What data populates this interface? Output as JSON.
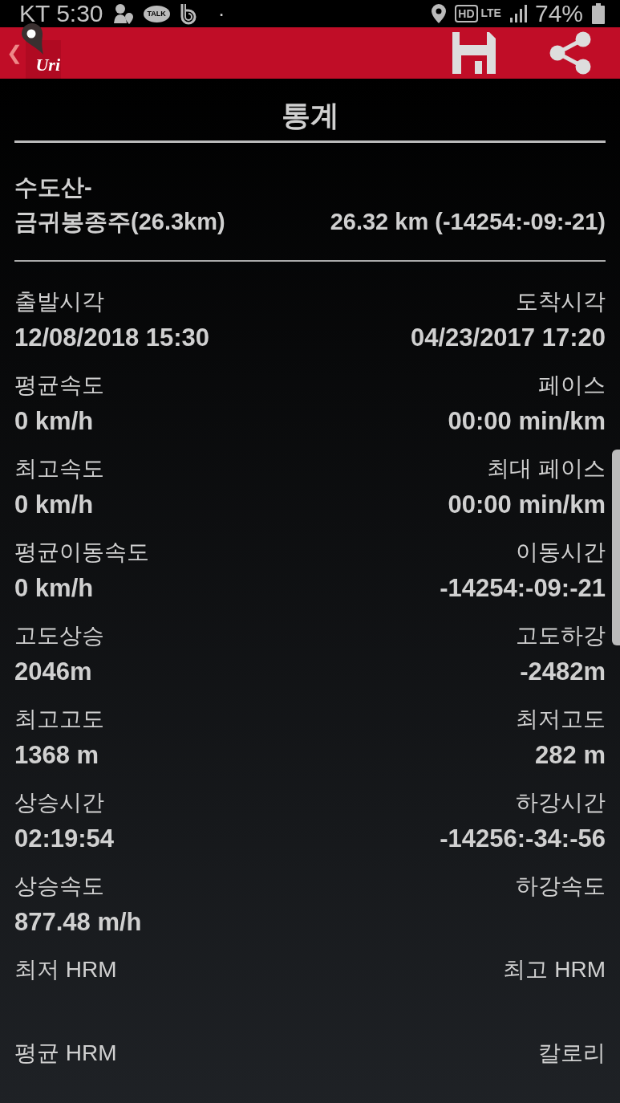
{
  "status_bar": {
    "carrier_time": "KT 5:30",
    "talk_badge": "TALK",
    "dot": "·",
    "hd": "HD",
    "network": "LTE",
    "battery": "74%"
  },
  "toolbar": {
    "back": "❮",
    "logo_text": "Uri"
  },
  "title": "통계",
  "track": {
    "name": "수도산-\n금귀봉종주(26.3km)",
    "summary": "26.32 km (-14254:-09:-21)"
  },
  "stats": [
    {
      "left": {
        "label": "출발시각",
        "value": "12/08/2018 15:30"
      },
      "right": {
        "label": "도착시각",
        "value": "04/23/2017 17:20"
      }
    },
    {
      "left": {
        "label": "평균속도",
        "value": "0 km/h"
      },
      "right": {
        "label": "페이스",
        "value": "00:00 min/km"
      }
    },
    {
      "left": {
        "label": "최고속도",
        "value": "0 km/h"
      },
      "right": {
        "label": "최대 페이스",
        "value": "00:00 min/km"
      }
    },
    {
      "left": {
        "label": "평균이동속도",
        "value": "0 km/h"
      },
      "right": {
        "label": "이동시간",
        "value": "-14254:-09:-21"
      }
    },
    {
      "left": {
        "label": "고도상승",
        "value": "2046m"
      },
      "right": {
        "label": "고도하강",
        "value": "-2482m"
      }
    },
    {
      "left": {
        "label": "최고고도",
        "value": "1368 m"
      },
      "right": {
        "label": "최저고도",
        "value": "282 m"
      }
    },
    {
      "left": {
        "label": "상승시간",
        "value": "02:19:54"
      },
      "right": {
        "label": "하강시간",
        "value": "-14256:-34:-56"
      }
    },
    {
      "left": {
        "label": "상승속도",
        "value": "877.48 m/h"
      },
      "right": {
        "label": "하강속도"
      }
    },
    {
      "left": {
        "label": "최저 HRM"
      },
      "right": {
        "label": "최고 HRM"
      }
    },
    {
      "left": {
        "label": "평균 HRM"
      },
      "right": {
        "label": "칼로리"
      }
    }
  ]
}
